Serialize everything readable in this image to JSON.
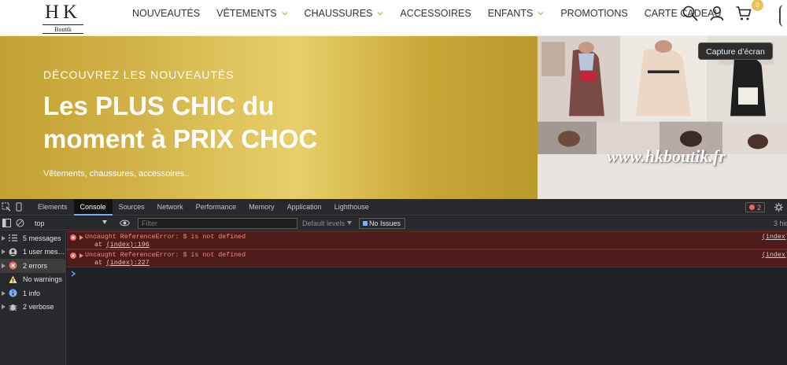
{
  "site": {
    "logo_text": "HK",
    "logo_sub": "Boutik",
    "nav": [
      {
        "label": "NOUVEAUTÉS",
        "has_dropdown": false
      },
      {
        "label": "VÊTEMENTS",
        "has_dropdown": true
      },
      {
        "label": "CHAUSSURES",
        "has_dropdown": true
      },
      {
        "label": "ACCESSOIRES",
        "has_dropdown": false
      },
      {
        "label": "ENFANTS",
        "has_dropdown": true
      },
      {
        "label": "PROMOTIONS",
        "has_dropdown": false
      },
      {
        "label": "CARTE CADEAU",
        "has_dropdown": false
      }
    ],
    "icons": [
      "search-icon",
      "user-icon",
      "cart-icon"
    ],
    "cart_count": "0",
    "colors": {
      "gold": "#d2b248",
      "badge": "#e8c15a"
    }
  },
  "hero": {
    "kicker": "DÉCOUVREZ LES NOUVEAUTÉS",
    "title": "Les PLUS CHIC du moment à PRIX CHOC",
    "description": "Vêtements, chaussures, accessoires..",
    "watermark": "www.hkboutik.fr"
  },
  "tooltip": "Capture d’écran",
  "devtools": {
    "tabs": [
      "Elements",
      "Console",
      "Sources",
      "Network",
      "Performance",
      "Memory",
      "Application",
      "Lighthouse"
    ],
    "active_tab": "Console",
    "error_count": "2",
    "context": "top",
    "filter_placeholder": "Filter",
    "levels": "Default levels",
    "issues": "No Issues",
    "hidden": "3 hid",
    "sidebar": [
      {
        "label": "5 messages",
        "icon": "list-icon",
        "color": "#c4c7c5"
      },
      {
        "label": "1 user mes…",
        "icon": "user-circle-icon",
        "color": "#c4c7c5"
      },
      {
        "label": "2 errors",
        "icon": "error-icon",
        "color": "#e46962"
      },
      {
        "label": "No warnings",
        "icon": "warning-icon",
        "color": "#fdd663"
      },
      {
        "label": "1 info",
        "icon": "info-icon",
        "color": "#7cacf8"
      },
      {
        "label": "2 verbose",
        "icon": "bug-icon",
        "color": "#c4c7c5"
      }
    ],
    "selected_sidebar": 2,
    "logs": [
      {
        "message": "Uncaught ReferenceError: $ is not defined",
        "at_prefix": "at ",
        "at": "(index):196",
        "source": "(index)"
      },
      {
        "message": "Uncaught ReferenceError: $ is not defined",
        "at_prefix": "at ",
        "at": "(index):227",
        "source": "(index)"
      }
    ]
  }
}
